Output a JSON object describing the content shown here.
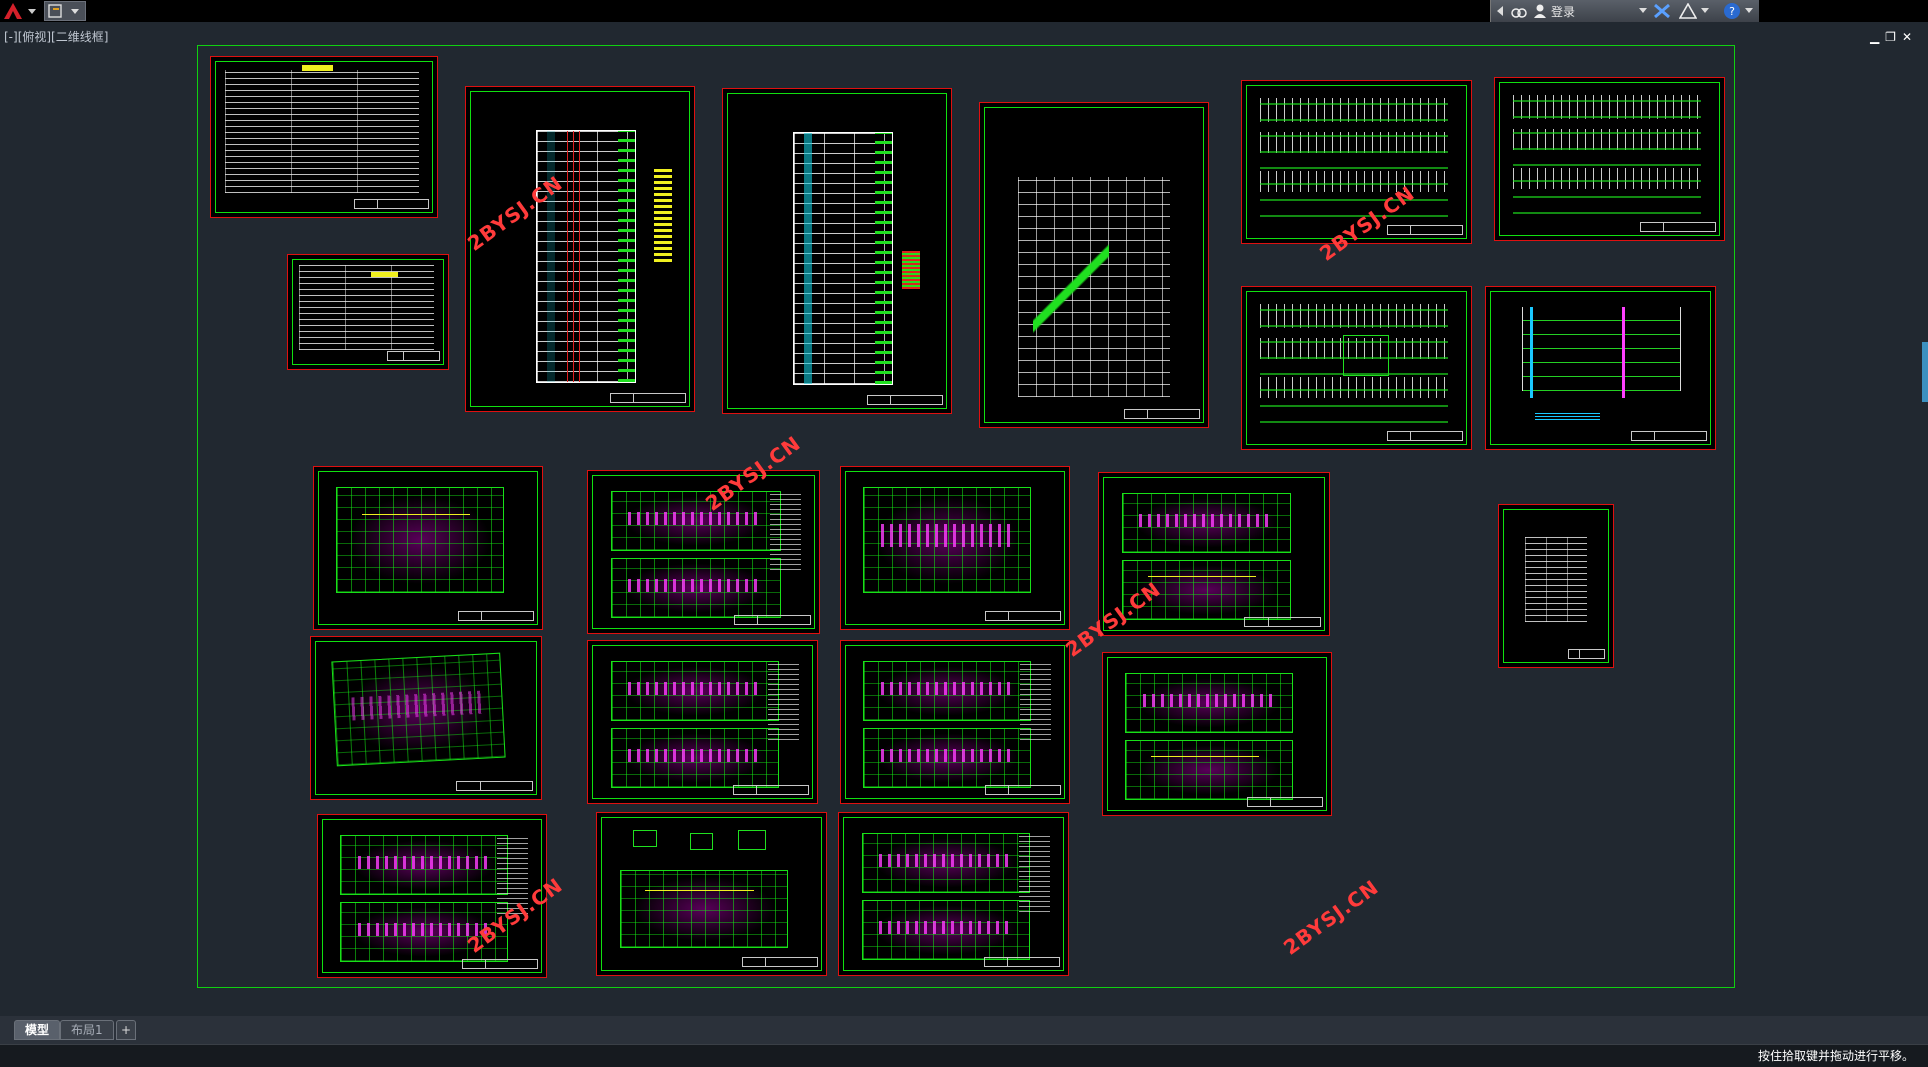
{
  "titlebar": {
    "login_label": "登录",
    "help_label": "?"
  },
  "viewport": {
    "label": "[-][俯视][二维线框]"
  },
  "watermarks": [
    {
      "text": "2BYSJ.CN"
    },
    {
      "text": "2BYSJ.CN"
    },
    {
      "text": "2BYSJ.CN"
    },
    {
      "text": "2BYSJ.CN"
    },
    {
      "text": "2BYSJ.CN"
    },
    {
      "text": "2BYSJ.CN"
    }
  ],
  "layout_tabs": [
    {
      "label": "模型",
      "active": true
    },
    {
      "label": "布局1",
      "active": false
    },
    {
      "label": "+",
      "active": false
    }
  ],
  "status": {
    "prompt": "按住拾取键并拖动进行平移。"
  },
  "colors": {
    "background": "#212830",
    "frame": "#10d010",
    "sheet_border": "#e01010",
    "watermark": "#ff3b3b"
  }
}
